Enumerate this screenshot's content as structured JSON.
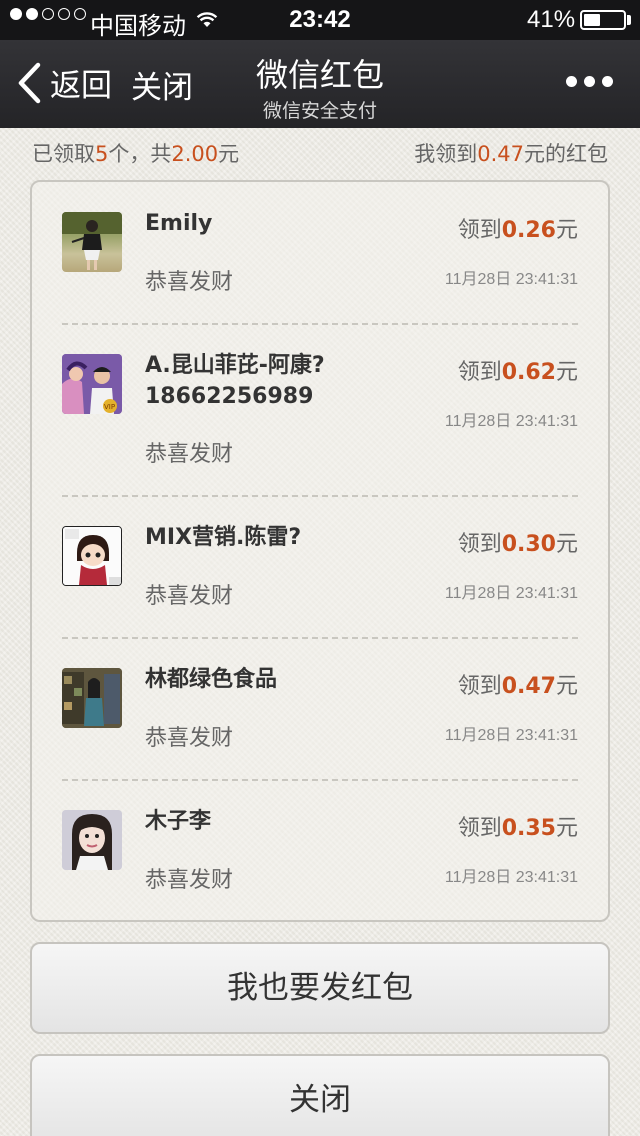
{
  "status_bar": {
    "carrier": "中国移动",
    "time": "23:42",
    "battery": "41%",
    "battery_level": 0.41,
    "signal_dots": [
      true,
      true,
      false,
      false,
      false
    ]
  },
  "nav": {
    "back_label": "返回",
    "close_label": "关闭",
    "title": "微信红包",
    "subtitle": "微信安全支付"
  },
  "summary": {
    "left_prefix": "已领取",
    "count": "5",
    "left_mid": "个，共",
    "total": "2.00",
    "left_suffix": "元",
    "right_prefix": "我领到",
    "my_amount": "0.47",
    "right_suffix": "元的红包"
  },
  "entries": [
    {
      "name": "Emily",
      "wish": "恭喜发财",
      "received_prefix": "领到",
      "amount": "0.26",
      "unit": "元",
      "time": "11月28日 23:41:31",
      "avatar": "avatar-photo-1"
    },
    {
      "name": "A.昆山菲芘-阿康?18662256989",
      "wish": "恭喜发财",
      "received_prefix": "领到",
      "amount": "0.62",
      "unit": "元",
      "time": "11月28日 23:41:31",
      "avatar": "avatar-photo-2",
      "badge": "VIP"
    },
    {
      "name": "MIX营销.陈雷?",
      "wish": "恭喜发财",
      "received_prefix": "领到",
      "amount": "0.30",
      "unit": "元",
      "time": "11月28日 23:41:31",
      "avatar": "avatar-cartoon-3"
    },
    {
      "name": "林都绿色食品",
      "wish": "恭喜发财",
      "received_prefix": "领到",
      "amount": "0.47",
      "unit": "元",
      "time": "11月28日 23:41:31",
      "avatar": "avatar-photo-4"
    },
    {
      "name": "木子李",
      "wish": "恭喜发财",
      "received_prefix": "领到",
      "amount": "0.35",
      "unit": "元",
      "time": "11月28日 23:41:31",
      "avatar": "avatar-photo-5"
    }
  ],
  "buttons": {
    "send": "我也要发红包",
    "close": "关闭"
  },
  "colors": {
    "accent": "#c8501e",
    "nav_bg": "#2b2b2e",
    "background": "#eceae3"
  }
}
